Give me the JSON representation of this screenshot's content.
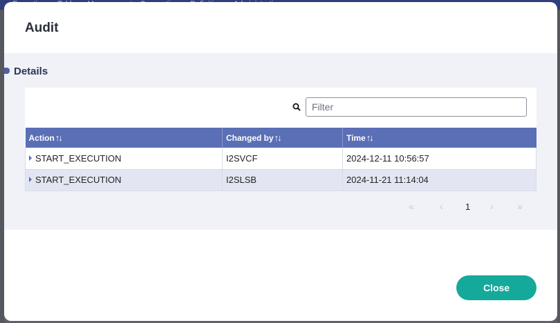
{
  "background": {
    "topbar_text": "Executions ▾   Tables ▾   Management ▾   Connections ▾   Definitions ▾   Administration ▾"
  },
  "modal": {
    "title": "Audit",
    "section_title": "Details",
    "filter": {
      "placeholder": "Filter",
      "value": ""
    },
    "table": {
      "columns": [
        {
          "label": "Action",
          "sort_icon": "↑↓"
        },
        {
          "label": "Changed by",
          "sort_icon": "↑↓"
        },
        {
          "label": "Time",
          "sort_icon": "↑↓"
        }
      ],
      "rows": [
        {
          "action": "START_EXECUTION",
          "changed_by": "I2SVCF",
          "time": "2024-12-11 10:56:57"
        },
        {
          "action": "START_EXECUTION",
          "changed_by": "I2SLSB",
          "time": "2024-11-21 11:14:04"
        }
      ]
    },
    "pagination": {
      "first": "«",
      "prev": "‹",
      "current_page": "1",
      "next": "›",
      "last": "»"
    },
    "close_label": "Close"
  },
  "colors": {
    "header": "#5b6fb6",
    "accent_button": "#14a99a",
    "body_bg": "#f1f2f8"
  }
}
